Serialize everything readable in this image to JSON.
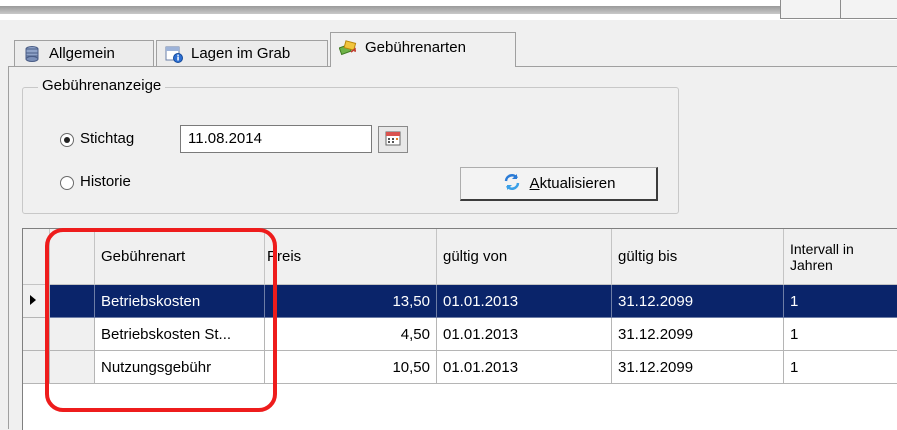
{
  "tabs": [
    {
      "label": "Allgemein",
      "icon": "database-icon",
      "active": false
    },
    {
      "label": "Lagen im Grab",
      "icon": "layers-info-icon",
      "active": false
    },
    {
      "label": "Gebührenarten",
      "icon": "money-exchange-icon",
      "active": true
    }
  ],
  "group": {
    "title": "Gebührenanzeige",
    "radio_stichtag": "Stichtag",
    "radio_historie": "Historie",
    "selected": "Stichtag",
    "date_value": "11.08.2014",
    "refresh_button": {
      "accel": "A",
      "rest": "ktualisieren"
    }
  },
  "grid": {
    "columns": [
      "",
      "Gebührenart",
      "Preis",
      "gültig von",
      "gültig bis",
      "Intervall in Jahren"
    ],
    "rows": [
      {
        "name": "Betriebskosten",
        "price": "13,50",
        "from": "01.01.2013",
        "to": "31.12.2099",
        "interval": "1",
        "selected": true
      },
      {
        "name": "Betriebskosten St...",
        "price": "4,50",
        "from": "01.01.2013",
        "to": "31.12.2099",
        "interval": "1",
        "selected": false
      },
      {
        "name": "Nutzungsgebühr",
        "price": "10,50",
        "from": "01.01.2013",
        "to": "31.12.2099",
        "interval": "1",
        "selected": false
      }
    ]
  },
  "colors": {
    "selection": "#0a246a",
    "highlight": "#ee1c1c"
  }
}
